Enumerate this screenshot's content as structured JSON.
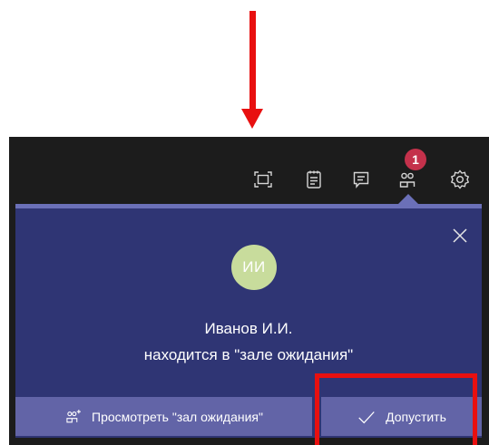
{
  "toolbar": {
    "icons": [
      "fullscreen-icon",
      "notes-icon",
      "chat-icon",
      "participants-icon",
      "settings-icon"
    ],
    "participants_badge": "1"
  },
  "lobby_card": {
    "avatar_initials": "ИИ",
    "person_name": "Иванов И.И.",
    "message": "находится в \"зале ожидания\"",
    "view_lobby_label": "Просмотреть \"зал ожидания\"",
    "admit_label": "Допустить"
  },
  "colors": {
    "card_bg": "#2f3574",
    "button_bg": "#6264a7",
    "badge": "#c4314b",
    "annotation": "#e81010"
  }
}
